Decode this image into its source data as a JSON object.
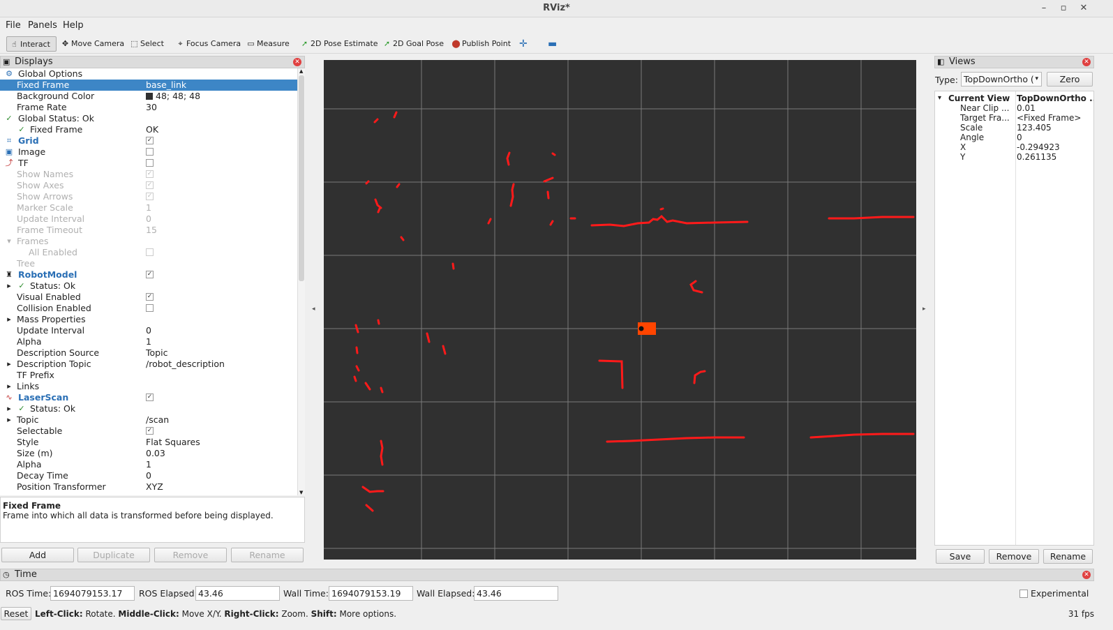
{
  "window": {
    "title": "RViz*"
  },
  "menu": [
    "File",
    "Panels",
    "Help"
  ],
  "toolbar": {
    "interact": "Interact",
    "move_camera": "Move Camera",
    "select": "Select",
    "focus_camera": "Focus Camera",
    "measure": "Measure",
    "pose_estimate": "2D Pose Estimate",
    "goal_pose": "2D Goal Pose",
    "publish_point": "Publish Point"
  },
  "displays": {
    "title": "Displays",
    "rows": [
      {
        "label": "Global Options",
        "value": ""
      },
      {
        "label": "Fixed Frame",
        "value": "base_link"
      },
      {
        "label": "Background Color",
        "value": "48; 48; 48"
      },
      {
        "label": "Frame Rate",
        "value": "30"
      },
      {
        "label": "Global Status: Ok",
        "value": ""
      },
      {
        "label": "Fixed Frame",
        "value": "OK"
      },
      {
        "label": "Grid",
        "value": ""
      },
      {
        "label": "Image",
        "value": ""
      },
      {
        "label": "TF",
        "value": ""
      },
      {
        "label": "Show Names",
        "value": ""
      },
      {
        "label": "Show Axes",
        "value": ""
      },
      {
        "label": "Show Arrows",
        "value": ""
      },
      {
        "label": "Marker Scale",
        "value": "1"
      },
      {
        "label": "Update Interval",
        "value": "0"
      },
      {
        "label": "Frame Timeout",
        "value": "15"
      },
      {
        "label": "Frames",
        "value": ""
      },
      {
        "label": "All Enabled",
        "value": ""
      },
      {
        "label": "Tree",
        "value": ""
      },
      {
        "label": "RobotModel",
        "value": ""
      },
      {
        "label": "Status: Ok",
        "value": ""
      },
      {
        "label": "Visual Enabled",
        "value": ""
      },
      {
        "label": "Collision Enabled",
        "value": ""
      },
      {
        "label": "Mass Properties",
        "value": ""
      },
      {
        "label": "Update Interval",
        "value": "0"
      },
      {
        "label": "Alpha",
        "value": "1"
      },
      {
        "label": "Description Source",
        "value": "Topic"
      },
      {
        "label": "Description Topic",
        "value": "/robot_description"
      },
      {
        "label": "TF Prefix",
        "value": ""
      },
      {
        "label": "Links",
        "value": ""
      },
      {
        "label": "LaserScan",
        "value": ""
      },
      {
        "label": "Status: Ok",
        "value": ""
      },
      {
        "label": "Topic",
        "value": "/scan"
      },
      {
        "label": "Selectable",
        "value": ""
      },
      {
        "label": "Style",
        "value": "Flat Squares"
      },
      {
        "label": "Size (m)",
        "value": "0.03"
      },
      {
        "label": "Alpha",
        "value": "1"
      },
      {
        "label": "Decay Time",
        "value": "0"
      },
      {
        "label": "Position Transformer",
        "value": "XYZ"
      }
    ],
    "description_title": "Fixed Frame",
    "description_text": "Frame into which all data is transformed before being displayed.",
    "buttons": {
      "add": "Add",
      "duplicate": "Duplicate",
      "remove": "Remove",
      "rename": "Rename"
    }
  },
  "views": {
    "title": "Views",
    "type_label": "Type:",
    "type_value": "TopDownOrtho (",
    "zero": "Zero",
    "current_view_label": "Current View",
    "current_view_value": "TopDownOrtho ...",
    "props": [
      {
        "label": "Near Clip ...",
        "value": "0.01"
      },
      {
        "label": "Target Fra...",
        "value": "<Fixed Frame>"
      },
      {
        "label": "Scale",
        "value": "123.405"
      },
      {
        "label": "Angle",
        "value": "0"
      },
      {
        "label": "X",
        "value": "-0.294923"
      },
      {
        "label": "Y",
        "value": "0.261135"
      }
    ],
    "buttons": {
      "save": "Save",
      "remove": "Remove",
      "rename": "Rename"
    }
  },
  "time": {
    "title": "Time",
    "ros_time_label": "ROS Time:",
    "ros_time": "1694079153.17",
    "ros_elapsed_label": "ROS Elapsed:",
    "ros_elapsed": "43.46",
    "wall_time_label": "Wall Time:",
    "wall_time": "1694079153.19",
    "wall_elapsed_label": "Wall Elapsed:",
    "wall_elapsed": "43.46",
    "experimental": "Experimental"
  },
  "status": {
    "reset": "Reset",
    "left_click": "Left-Click:",
    "left_action": " Rotate. ",
    "middle_click": "Middle-Click:",
    "middle_action": " Move X/Y. ",
    "right_click": "Right-Click:",
    "right_action": " Zoom. ",
    "shift": "Shift:",
    "shift_action": " More options.",
    "fps": "31 fps"
  },
  "colors": {
    "scan": "#ff1a1a",
    "robot": "#ff4500",
    "background": "#303030",
    "grid": "#a0a0a0",
    "selection": "#3d86c6"
  }
}
